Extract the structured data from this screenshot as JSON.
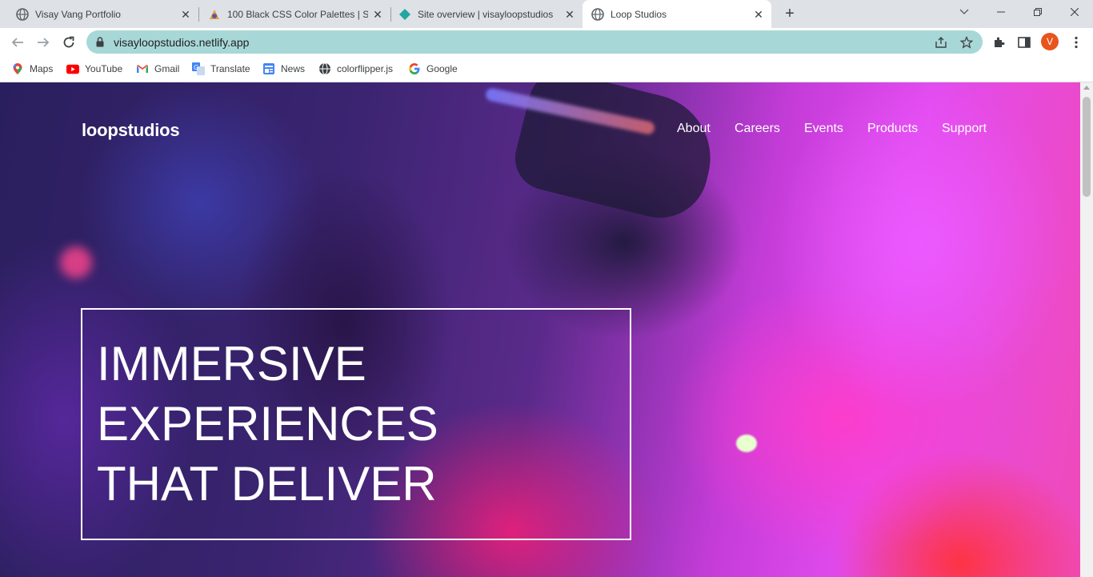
{
  "browser": {
    "tabs": [
      {
        "title": "Visay Vang Portfolio",
        "icon": "globe-icon"
      },
      {
        "title": "100 Black CSS Color Palettes | Sh",
        "icon": "palette-icon"
      },
      {
        "title": "Site overview | visayloopstudios",
        "icon": "netlify-icon"
      },
      {
        "title": "Loop Studios",
        "icon": "globe-icon",
        "active": true
      }
    ],
    "new_tab": "+",
    "address": "visayloopstudios.netlify.app",
    "profile_initial": "V",
    "colors": {
      "tabstrip": "#dee1e6",
      "omnibox": "#a8d7d7",
      "avatar": "#e8541c"
    }
  },
  "bookmarks": [
    {
      "label": "Maps",
      "icon": "maps-icon"
    },
    {
      "label": "YouTube",
      "icon": "youtube-icon"
    },
    {
      "label": "Gmail",
      "icon": "gmail-icon"
    },
    {
      "label": "Translate",
      "icon": "translate-icon"
    },
    {
      "label": "News",
      "icon": "news-icon"
    },
    {
      "label": "colorflipper.js",
      "icon": "globe-icon"
    },
    {
      "label": "Google",
      "icon": "google-icon"
    }
  ],
  "site": {
    "brand": "loopstudios",
    "nav": [
      "About",
      "Careers",
      "Events",
      "Products",
      "Support"
    ],
    "hero": [
      "IMMERSIVE",
      "EXPERIENCES",
      "THAT DELIVER"
    ]
  }
}
